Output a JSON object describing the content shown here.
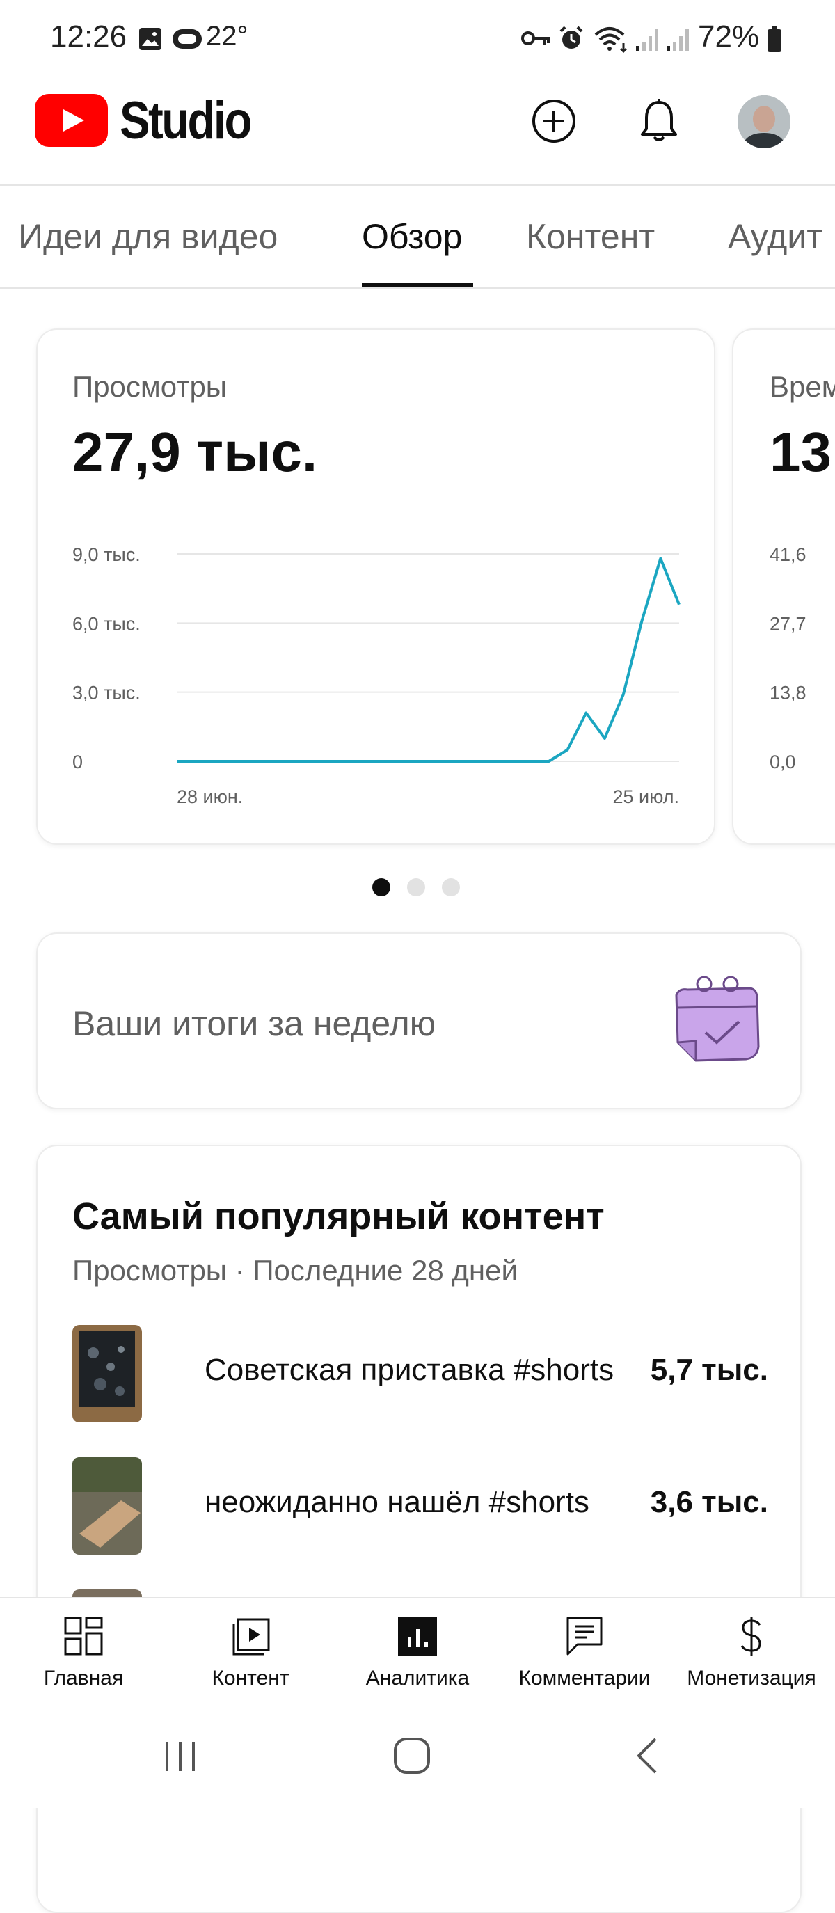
{
  "status_bar": {
    "time": "12:26",
    "temperature": "22°",
    "battery": "72%"
  },
  "header": {
    "logo_text": "Studio"
  },
  "tabs": [
    {
      "label": "Идеи для видео",
      "active": false
    },
    {
      "label": "Обзор",
      "active": true
    },
    {
      "label": "Контент",
      "active": false
    },
    {
      "label": "Аудит",
      "active": false
    }
  ],
  "metric_cards": [
    {
      "label": "Просмотры",
      "value": "27,9 тыс."
    },
    {
      "label": "Врем",
      "value": "13"
    }
  ],
  "chart_data": [
    {
      "type": "line",
      "title": "Просмотры",
      "x_tick_labels": [
        "28 июн.",
        "25 июл."
      ],
      "y_tick_labels": [
        "9,0 тыс.",
        "6,0 тыс.",
        "3,0 тыс.",
        "0"
      ],
      "ylim": [
        0,
        9000
      ],
      "grid": true,
      "x": [
        "28 июн.",
        "29 июн.",
        "30 июн.",
        "1 июл.",
        "2 июл.",
        "3 июл.",
        "4 июл.",
        "5 июл.",
        "6 июл.",
        "7 июл.",
        "8 июл.",
        "9 июл.",
        "10 июл.",
        "11 июл.",
        "12 июл.",
        "13 июл.",
        "14 июл.",
        "15 июл.",
        "16 июл.",
        "17 июл.",
        "18 июл.",
        "19 июл.",
        "20 июл.",
        "21 июл.",
        "22 июл.",
        "23 июл.",
        "24 июл.",
        "25 июл."
      ],
      "series": [
        {
          "values": [
            0,
            0,
            0,
            0,
            0,
            0,
            0,
            0,
            0,
            0,
            0,
            0,
            0,
            0,
            0,
            0,
            0,
            0,
            0,
            0,
            0,
            500,
            2100,
            1000,
            2900,
            6100,
            8800,
            6800
          ]
        }
      ],
      "color": "#1ba6c1"
    },
    {
      "type": "line",
      "title": "Врем",
      "y_tick_labels": [
        "41,6",
        "27,7",
        "13,8",
        "0,0"
      ],
      "ylim": [
        0,
        41.6
      ]
    }
  ],
  "pager": {
    "count": 3,
    "active": 0
  },
  "weekly_summary": {
    "text": "Ваши итоги за неделю"
  },
  "popular": {
    "title": "Самый популярный контент",
    "subtitle": "Просмотры · Последние 28 дней",
    "items": [
      {
        "title": "Советская приставка #shorts",
        "views": "5,7 тыс."
      },
      {
        "title": "неожиданно нашёл #shorts",
        "views": "3,6 тыс."
      }
    ]
  },
  "bottom_nav": [
    {
      "label": "Главная",
      "icon": "dashboard-icon",
      "active": false
    },
    {
      "label": "Контент",
      "icon": "content-icon",
      "active": false
    },
    {
      "label": "Аналитика",
      "icon": "analytics-icon",
      "active": true
    },
    {
      "label": "Комментарии",
      "icon": "comments-icon",
      "active": false
    },
    {
      "label": "Монетизация",
      "icon": "monetization-icon",
      "active": false
    }
  ],
  "colors": {
    "accent": "#1ba6c1",
    "youtube_red": "#ff0000",
    "summary_icon": "#c9a5ea"
  }
}
